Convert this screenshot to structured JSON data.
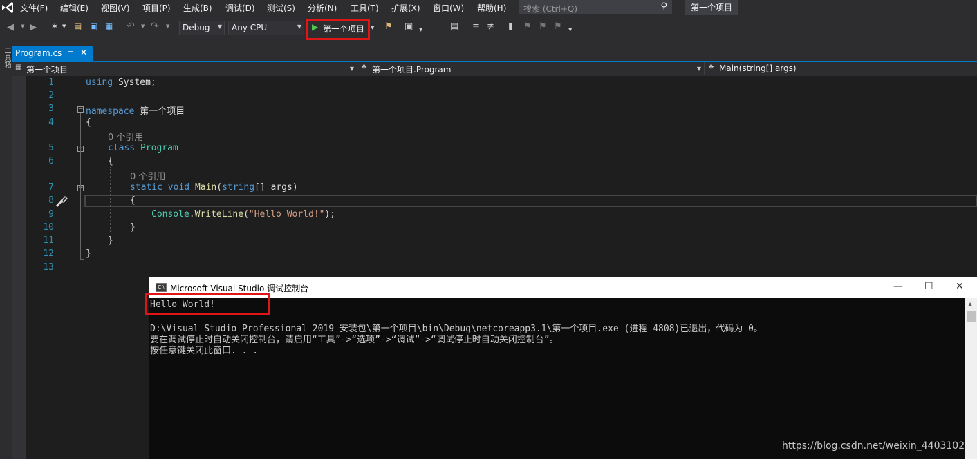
{
  "menubar": {
    "items": [
      "文件(F)",
      "编辑(E)",
      "视图(V)",
      "项目(P)",
      "生成(B)",
      "调试(D)",
      "测试(S)",
      "分析(N)",
      "工具(T)",
      "扩展(X)",
      "窗口(W)",
      "帮助(H)"
    ],
    "search_placeholder": "搜索 (Ctrl+Q)",
    "search_icon": "search-icon",
    "project_title": "第一个项目"
  },
  "toolbar": {
    "config": "Debug",
    "platform": "Any CPU",
    "run_label": "第一个项目",
    "highlight_color": "#e01515"
  },
  "sidebar": {
    "label": "工具箱"
  },
  "tab": {
    "name": "Program.cs",
    "pin": "⊣",
    "close": "✕"
  },
  "navbar": {
    "project": "第一个项目",
    "class": "第一个项目.Program",
    "member": "Main(string[] args)"
  },
  "editor": {
    "line_numbers": [
      "1",
      "2",
      "3",
      "4",
      "5",
      "6",
      "7",
      "8",
      "9",
      "10",
      "11",
      "12",
      "13"
    ],
    "code": {
      "using_kw": "using",
      "using_rest": " System;",
      "ns_kw": "namespace",
      "ns_name": " 第一个项目",
      "ref1": "0 个引用",
      "class_kw": "class",
      "class_name": "Program",
      "ref2": "0 个引用",
      "static_kw": "static",
      "void_kw": "void",
      "main_name": "Main",
      "string_kw": "string",
      "args_rest": "[] args)",
      "console_type": "Console",
      "writeline": "WriteLine",
      "hello_str": "\"Hello World!\"",
      "brace_open": "{",
      "brace_close": "}",
      "paren_open": "(",
      "dot": ".",
      "stmt_end": ");"
    }
  },
  "console": {
    "title": "Microsoft Visual Studio 调试控制台",
    "icon_text": "C:\\",
    "lines": [
      "Hello World!",
      "",
      "D:\\Visual Studio Professional 2019 安装包\\第一个项目\\bin\\Debug\\netcoreapp3.1\\第一个项目.exe (进程 4808)已退出，代码为 0。",
      "要在调试停止时自动关闭控制台，请启用“工具”->“选项”->“调试”->“调试停止时自动关闭控制台”。",
      "按任意键关闭此窗口. . ."
    ]
  },
  "watermark": "https://blog.csdn.net/weixin_4403102"
}
